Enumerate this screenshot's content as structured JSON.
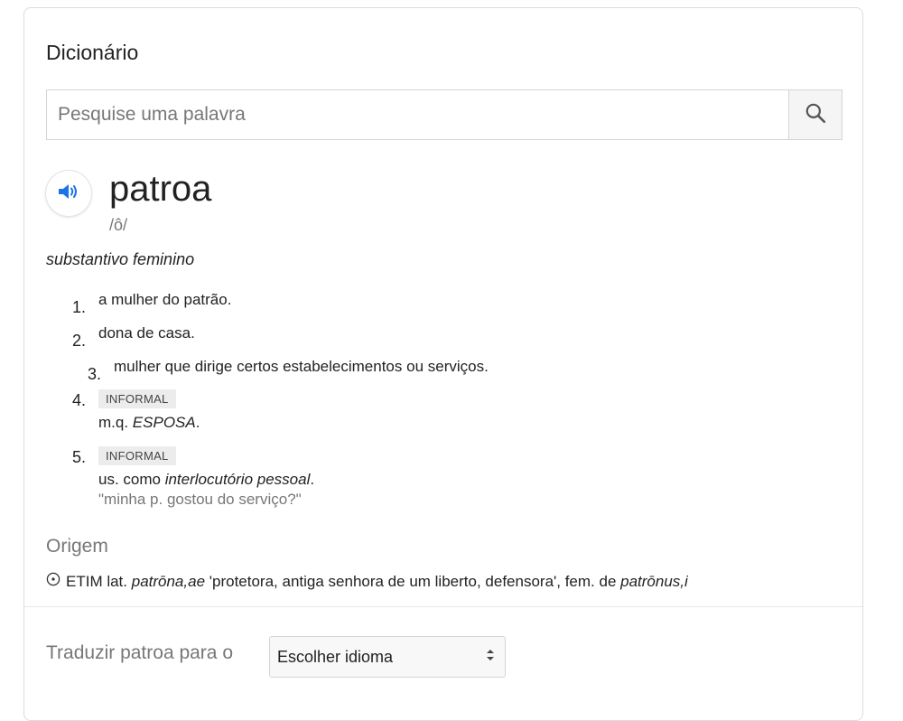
{
  "dictionary": {
    "title": "Dicionário",
    "search": {
      "placeholder": "Pesquise uma palavra",
      "icon": "search-icon"
    },
    "speaker_icon": "speaker-icon",
    "word": "patroa",
    "phonetic": "/ô/",
    "part_of_speech": "substantivo feminino",
    "definitions": [
      {
        "number": "1.",
        "text": "a mulher do patrão."
      },
      {
        "number": "2.",
        "text": "dona de casa."
      },
      {
        "number": "3.",
        "text": "mulher que dirige certos estabelecimentos ou serviços."
      },
      {
        "number": "4.",
        "badge": "INFORMAL",
        "prefix": "m.q. ",
        "emph": "ESPOSA",
        "suffix": "."
      },
      {
        "number": "5.",
        "badge": "INFORMAL",
        "prefix": "us. como ",
        "emph": "interlocutório pessoal",
        "suffix": ".",
        "example": "\"minha p. gostou do serviço?\""
      }
    ],
    "origin": {
      "heading": "Origem",
      "icon": "expand-circle-icon",
      "p1": "ETIM lat. ",
      "e1": "patrōna,ae",
      "p2": " 'protetora, antiga senhora de um liberto, defensora', fem. de ",
      "e2": "patrōnus,i"
    },
    "translate": {
      "label": "Traduzir patroa para o",
      "select_value": "Escolher idioma"
    }
  },
  "colors": {
    "accent": "#1a73e8",
    "muted": "#777777",
    "badge_bg": "#ececec"
  }
}
